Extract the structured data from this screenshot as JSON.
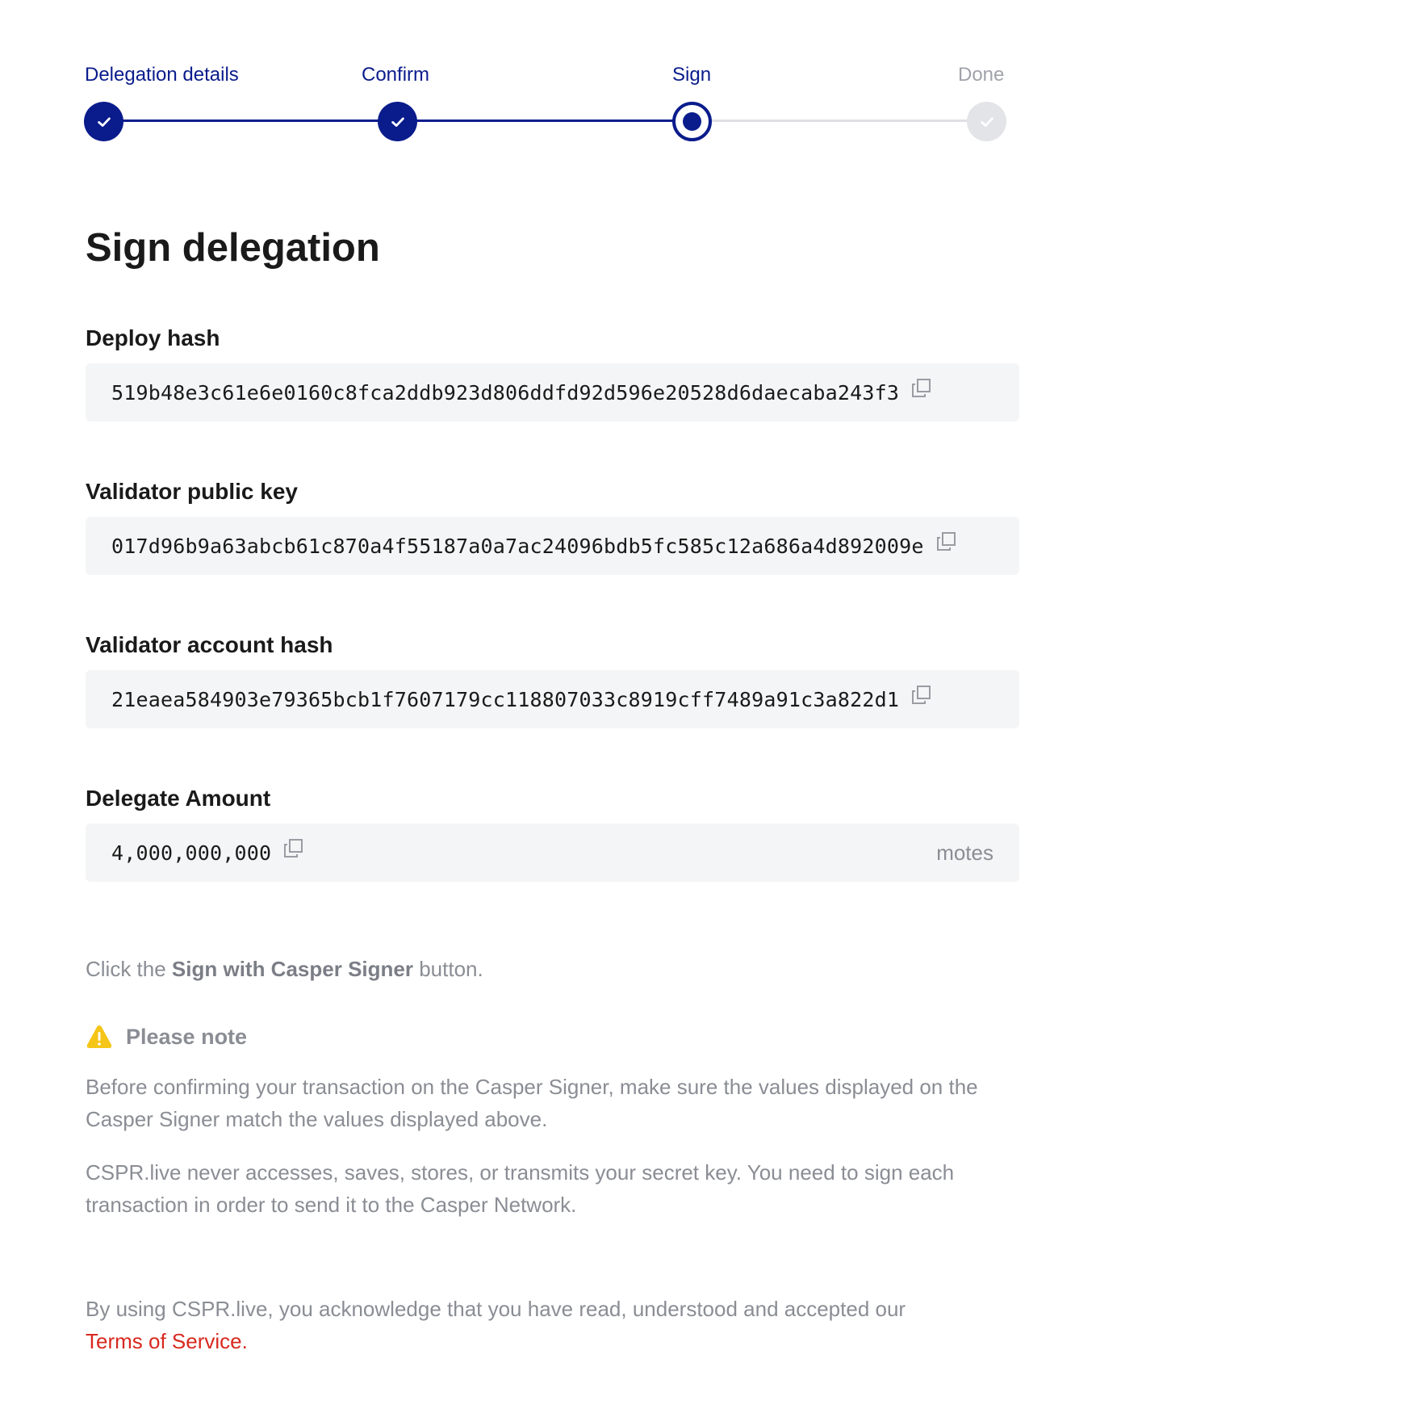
{
  "stepper": {
    "steps": [
      {
        "label": "Delegation details",
        "state": "done"
      },
      {
        "label": "Confirm",
        "state": "done"
      },
      {
        "label": "Sign",
        "state": "current"
      },
      {
        "label": "Done",
        "state": "pending"
      }
    ]
  },
  "page_title": "Sign delegation",
  "fields": {
    "deploy_hash": {
      "label": "Deploy hash",
      "value": "519b48e3c61e6e0160c8fca2ddb923d806ddfd92d596e20528d6daecaba243f3"
    },
    "validator_public_key": {
      "label": "Validator public key",
      "value": "017d96b9a63abcb61c870a4f55187a0a7ac24096bdb5fc585c12a686a4d892009e"
    },
    "validator_account_hash": {
      "label": "Validator account hash",
      "value": "21eaea584903e79365bcb1f7607179cc118807033c8919cff7489a91c3a822d1"
    },
    "delegate_amount": {
      "label": "Delegate Amount",
      "value": "4,000,000,000",
      "unit": "motes"
    }
  },
  "instructions": {
    "prefix": "Click the ",
    "button_name": "Sign with Casper Signer",
    "suffix": " button."
  },
  "note": {
    "heading": "Please note",
    "paragraph_1": "Before confirming your transaction on the Casper Signer, make sure the values displayed on the Casper Signer match the values displayed above.",
    "paragraph_2": "CSPR.live never accesses, saves, stores, or transmits your secret key. You need to sign each transaction in order to send it to the Casper Network."
  },
  "footer": {
    "text": "By using CSPR.live, you acknowledge that you have read, understood and accepted our ",
    "link_label": "Terms of Service."
  },
  "colors": {
    "primary": "#0a1c8c",
    "pending": "#dfe0e3",
    "muted_text": "#8a8d94",
    "field_bg": "#f4f5f6",
    "warning": "#f5c518",
    "link": "#d8291f"
  }
}
